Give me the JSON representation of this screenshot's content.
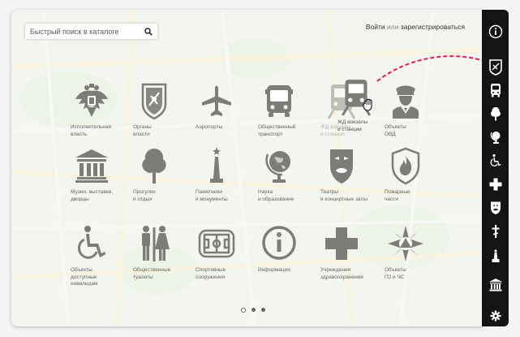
{
  "search": {
    "placeholder": "Быстрый поиск в каталоге"
  },
  "auth": {
    "login": "Войти",
    "or": "или",
    "register": "зарегистрироваться"
  },
  "categories": [
    {
      "icon": "coat-of-arms-icon",
      "label": "Исполнительная\nвласть"
    },
    {
      "icon": "shield-emblem-icon",
      "label": "Органы\nвласти"
    },
    {
      "icon": "airplane-icon",
      "label": "Аэропорты"
    },
    {
      "icon": "bus-icon",
      "label": "Общественный\nтранспорт"
    },
    {
      "icon": "train-icon",
      "label": "ЖД вокзалы\nи станции"
    },
    {
      "icon": "police-officer-icon",
      "label": "Объекты\nОВД"
    },
    {
      "icon": "museum-icon",
      "label": "Музеи, выставки,\nдворцы"
    },
    {
      "icon": "tree-icon",
      "label": "Прогулки\nи отдых"
    },
    {
      "icon": "monument-icon",
      "label": "Памятники\nи монументы"
    },
    {
      "icon": "globe-icon",
      "label": "Наука\nи образование"
    },
    {
      "icon": "theatre-mask-icon",
      "label": "Театры\nи концертные залы"
    },
    {
      "icon": "fire-shield-icon",
      "label": "Пожарные\nчасти"
    },
    {
      "icon": "wheelchair-icon",
      "label": "Объекты\nдоступные\nинвалидам"
    },
    {
      "icon": "toilet-icon",
      "label": "Общественные\nтуалеты"
    },
    {
      "icon": "stadium-icon",
      "label": "Спортивные\nсооружения"
    },
    {
      "icon": "info-icon",
      "label": "Информация"
    },
    {
      "icon": "medical-cross-icon",
      "label": "Учреждения\nздравоохранения"
    },
    {
      "icon": "civil-defense-icon",
      "label": "Объекты\nГО и ЧС"
    }
  ],
  "drag_ghost_label": "ЖД вокзалы\nи станции",
  "pagination": {
    "pages": 3,
    "current": 1
  },
  "rail": [
    "info-icon",
    "emblem-icon",
    "bus-icon",
    "tree-icon",
    "globe-icon",
    "wheelchair-icon",
    "medical-cross-icon",
    "theatre-mask-icon",
    "church-cross-icon",
    "monument-icon",
    "museum-icon",
    "gear-icon"
  ],
  "colors": {
    "icon_gray": "#7d7c79",
    "rail_bg": "#141414",
    "arrow": "#e8185f",
    "text": "#333333"
  }
}
